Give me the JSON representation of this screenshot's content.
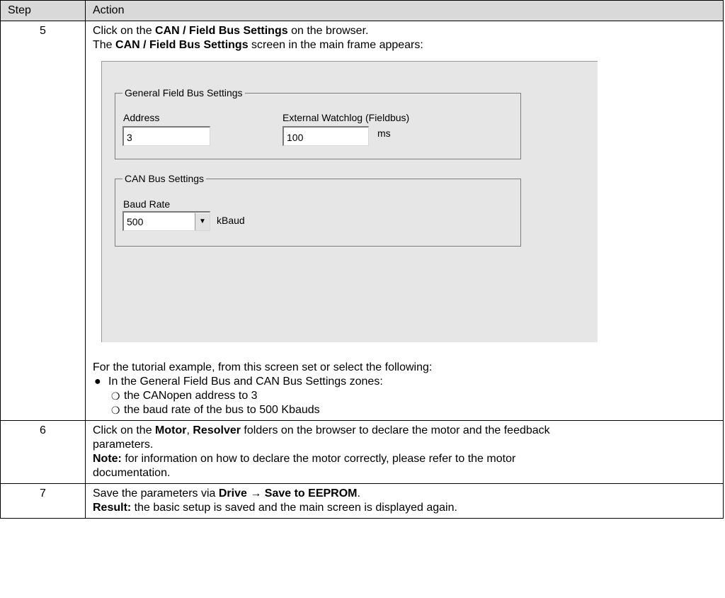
{
  "table": {
    "header": {
      "step": "Step",
      "action": "Action"
    },
    "row5": {
      "step": "5",
      "line1": {
        "pre": "Click on the ",
        "bold": "CAN / Field Bus Settings",
        "post": " on the browser."
      },
      "line2": {
        "pre": "The ",
        "bold": "CAN / Field Bus Settings",
        "post": " screen in the main frame appears:"
      },
      "screen": {
        "general_group_title": "General Field Bus Settings",
        "address_label": "Address",
        "address_value": "3",
        "watchdog_label": "External Watchlog (Fieldbus)",
        "watchdog_value": "100",
        "watchdog_unit": "ms",
        "can_group_title": "CAN Bus Settings",
        "baud_label": "Baud Rate",
        "baud_value": "500",
        "baud_unit": "kBaud"
      },
      "after_intro": "For the tutorial example, from this screen set or select the following:",
      "bullet1": "In the General Field Bus and CAN Bus Settings zones:",
      "sub1": "the CANopen address to 3",
      "sub2": "the baud rate of the bus to 500 Kbauds"
    },
    "row6": {
      "step": "6",
      "line1": {
        "pre": "Click on the ",
        "bold1": "Motor",
        "mid": ", ",
        "bold2": "Resolver",
        "post": " folders on the browser to declare the motor and the feedback"
      },
      "line2": "parameters.",
      "note_label": "Note:",
      "note_text": " for information on how to declare the motor correctly, please refer to the motor",
      "note_line2": "documentation."
    },
    "row7": {
      "step": "7",
      "line1": {
        "pre": "Save the parameters via ",
        "bold": "Drive → Save to EEPROM",
        "post": "."
      },
      "result_label": "Result:",
      "result_text": " the basic setup is saved and the main screen is displayed again."
    }
  },
  "icons": {
    "bullet": "●",
    "sub_bullet": "❍",
    "dropdown": "▼"
  }
}
